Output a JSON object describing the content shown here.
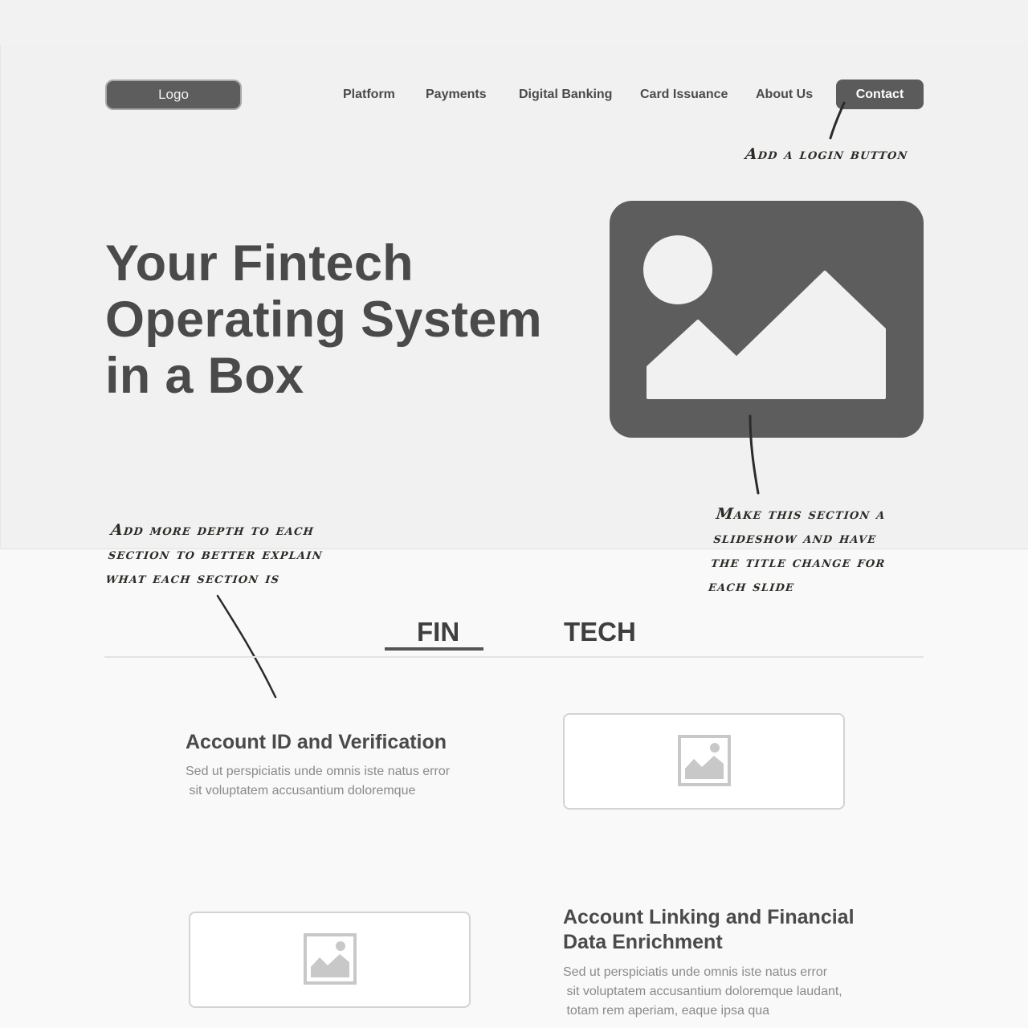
{
  "header": {
    "logo_label": "Logo",
    "nav": [
      {
        "label": "Platform"
      },
      {
        "label": "Payments"
      },
      {
        "label": "Digital Banking"
      },
      {
        "label": "Card Issuance"
      },
      {
        "label": "About Us"
      }
    ],
    "contact_label": "Contact"
  },
  "hero": {
    "title_lines": [
      "Your Fintech",
      "Operating System",
      "in a Box"
    ],
    "image_icon": "image-placeholder-icon"
  },
  "annotations": {
    "login": [
      "Add a login button"
    ],
    "slideshow": [
      "Make this section a",
      "slideshow and have",
      "the title change for",
      "each slide"
    ],
    "depth": [
      "Add more depth to each",
      "section to better explain",
      "what each section is"
    ]
  },
  "tabs": [
    {
      "label": "FIN",
      "active": true
    },
    {
      "label": "TECH",
      "active": false
    }
  ],
  "features": [
    {
      "title_lines": [
        "Account ID and Verification"
      ],
      "desc_lines": [
        "Sed ut perspiciatis unde omnis iste natus error",
        " sit voluptatem accusantium doloremque"
      ],
      "image_icon": "image-placeholder-icon"
    },
    {
      "title_lines": [
        "Account Linking and Financial",
        "Data Enrichment"
      ],
      "desc_lines": [
        "Sed ut perspiciatis unde omnis iste natus error",
        " sit voluptatem accusantium doloremque laudant,",
        " totam rem aperiam, eaque ipsa qua"
      ],
      "image_icon": "image-placeholder-icon"
    }
  ],
  "colors": {
    "hero_bg": "#f1f1f1",
    "page_bg": "#f9f9f9",
    "dark_fill": "#5d5d5d",
    "text": "#4a4a4a",
    "muted_text": "#8a8a8a",
    "annotation_ink": "#2e2a26"
  }
}
